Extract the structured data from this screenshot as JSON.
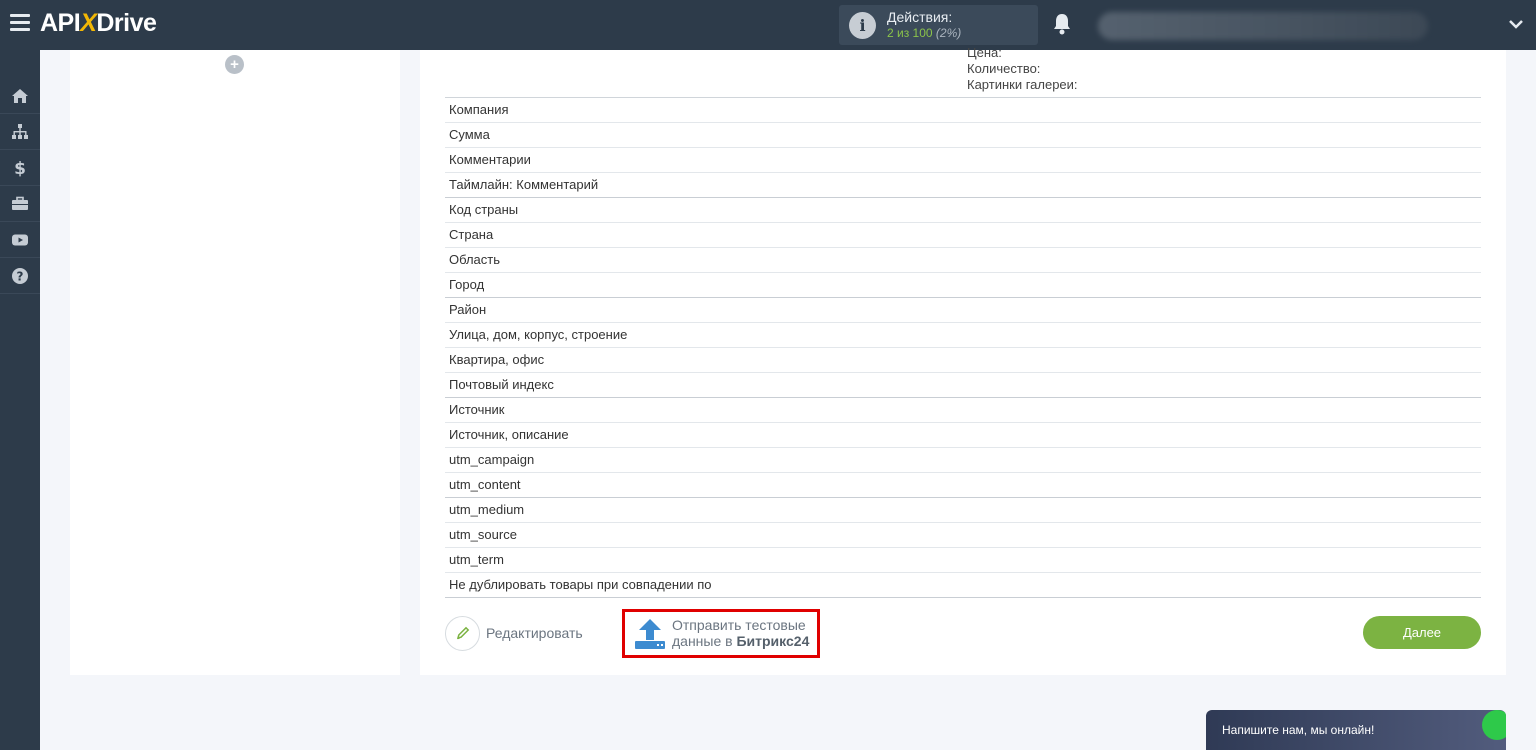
{
  "topbar": {
    "logo_prefix": "API",
    "logo_x": "X",
    "logo_suffix": "Drive",
    "actions_label": "Действия:",
    "actions_count": "2 из 100",
    "actions_percent": "(2%)"
  },
  "sidebar": {
    "items": [
      {
        "icon": "home-icon"
      },
      {
        "icon": "sitemap-icon"
      },
      {
        "icon": "dollar-icon"
      },
      {
        "icon": "briefcase-icon"
      },
      {
        "icon": "video-icon"
      },
      {
        "icon": "help-icon"
      }
    ]
  },
  "left_panel": {
    "add_symbol": "+"
  },
  "main": {
    "top_labels": [
      "Цена:",
      "Количество:",
      "Картинки галереи:"
    ],
    "fields": [
      "Компания",
      "Сумма",
      "Комментарии",
      "Таймлайн: Комментарий",
      "Код страны",
      "Страна",
      "Область",
      "Город",
      "Район",
      "Улица, дом, корпус, строение",
      "Квартира, офис",
      "Почтовый индекс",
      "Источник",
      "Источник, описание",
      "utm_campaign",
      "utm_content",
      "utm_medium",
      "utm_source",
      "utm_term",
      "Не дублировать товары при совпадении по"
    ],
    "edit_label": "Редактировать",
    "send_line1": "Отправить тестовые",
    "send_line2_prefix": "данные в ",
    "send_line2_bold": "Битрикс24",
    "next_label": "Далее"
  },
  "chat": {
    "text": "Напишите нам, мы онлайн!"
  },
  "colors": {
    "topbar": "#2d3b4a",
    "accent_green": "#7cb342",
    "highlight_red": "#e00000",
    "logo_x": "#f2b705"
  }
}
